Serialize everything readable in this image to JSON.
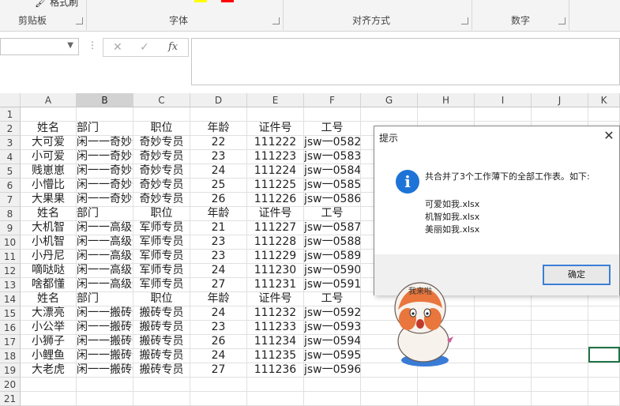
{
  "ribbon": {
    "format_painter": "格式刷",
    "groups": [
      "剪贴板",
      "字体",
      "对齐方式",
      "数字"
    ],
    "colors": {
      "highlight": "#ffff00",
      "font_color": "#ff0000"
    }
  },
  "formula_bar": {
    "name_box": "",
    "dots": "⋮",
    "cancel_icon": "✕",
    "enter_icon": "✓",
    "fx_label": "fx",
    "content": ""
  },
  "columns": [
    "A",
    "B",
    "C",
    "D",
    "E",
    "F",
    "G",
    "H",
    "I",
    "J",
    "K"
  ],
  "rows": [
    "1",
    "2",
    "3",
    "4",
    "5",
    "6",
    "7",
    "8",
    "9",
    "10",
    "11",
    "12",
    "13",
    "14",
    "15",
    "16",
    "17",
    "18",
    "19",
    "20",
    "21"
  ],
  "cells": [
    [],
    [
      "姓名",
      "部门",
      "职位",
      "年龄",
      "证件号",
      "工号"
    ],
    [
      "大可爱",
      "闲一一奇妙部",
      "奇妙专员",
      "22",
      "111222",
      "jsw一0582"
    ],
    [
      "小可爱",
      "闲一一奇妙部",
      "奇妙专员",
      "23",
      "111223",
      "jsw一0583"
    ],
    [
      "贱崽崽",
      "闲一一奇妙部",
      "奇妙专员",
      "24",
      "111224",
      "jsw一0584"
    ],
    [
      "小懵比",
      "闲一一奇妙部",
      "奇妙专员",
      "25",
      "111225",
      "jsw一0585"
    ],
    [
      "大果果",
      "闲一一奇妙部",
      "奇妙专员",
      "26",
      "111226",
      "jsw一0586"
    ],
    [
      "姓名",
      "部门",
      "职位",
      "年龄",
      "证件号",
      "工号"
    ],
    [
      "大机智",
      "闲一一高级部",
      "军师专员",
      "21",
      "111227",
      "jsw一0587"
    ],
    [
      "小机智",
      "闲一一高级部",
      "军师专员",
      "23",
      "111228",
      "jsw一0588"
    ],
    [
      "小丹尼",
      "闲一一高级部",
      "军师专员",
      "23",
      "111229",
      "jsw一0589"
    ],
    [
      "嘀哒哒",
      "闲一一高级部",
      "军师专员",
      "24",
      "111230",
      "jsw一0590"
    ],
    [
      "啥都懂",
      "闲一一高级部",
      "军师专员",
      "27",
      "111231",
      "jsw一0591"
    ],
    [
      "姓名",
      "部门",
      "职位",
      "年龄",
      "证件号",
      "工号"
    ],
    [
      "大漂亮",
      "闲一一搬砖部",
      "搬砖专员",
      "24",
      "111232",
      "jsw一0592"
    ],
    [
      "小公举",
      "闲一一搬砖部",
      "搬砖专员",
      "23",
      "111233",
      "jsw一0593"
    ],
    [
      "小狮子",
      "闲一一搬砖部",
      "搬砖专员",
      "26",
      "111234",
      "jsw一0594"
    ],
    [
      "小鲤鱼",
      "闲一一搬砖部",
      "搬砖专员",
      "24",
      "111235",
      "jsw一0595"
    ],
    [
      "大老虎",
      "闲一一搬砖部",
      "搬砖专员",
      "27",
      "111236",
      "jsw一0596"
    ],
    [],
    []
  ],
  "selected_column": "B",
  "dialog": {
    "title": "提示",
    "close_icon": "✕",
    "info_icon": "i",
    "message": "共合并了3个工作薄下的全部工作表。如下:",
    "files": [
      "可爱如我.xlsx",
      "机智如我.xlsx",
      "美丽如我.xlsx"
    ],
    "ok_label": "确定"
  },
  "sticker": {
    "caption": "我来啦"
  }
}
